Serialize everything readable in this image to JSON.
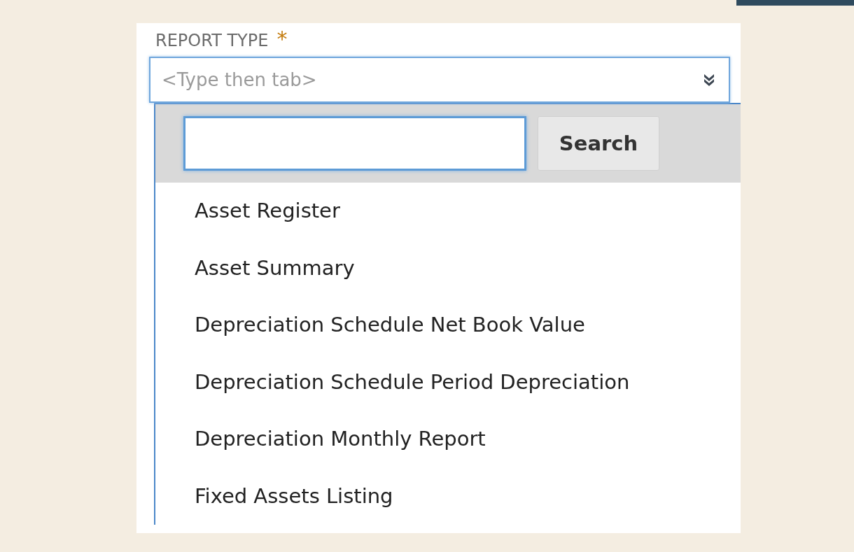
{
  "field": {
    "label": "REPORT TYPE",
    "required_mark": "*",
    "placeholder": "<Type then tab>"
  },
  "dropdown": {
    "search_button": "Search",
    "items": [
      {
        "label": "Asset Register"
      },
      {
        "label": "Asset Summary"
      },
      {
        "label": "Depreciation Schedule Net Book Value"
      },
      {
        "label": "Depreciation Schedule Period Depreciation"
      },
      {
        "label": "Depreciation Monthly Report"
      },
      {
        "label": "Fixed Assets Listing"
      }
    ]
  }
}
